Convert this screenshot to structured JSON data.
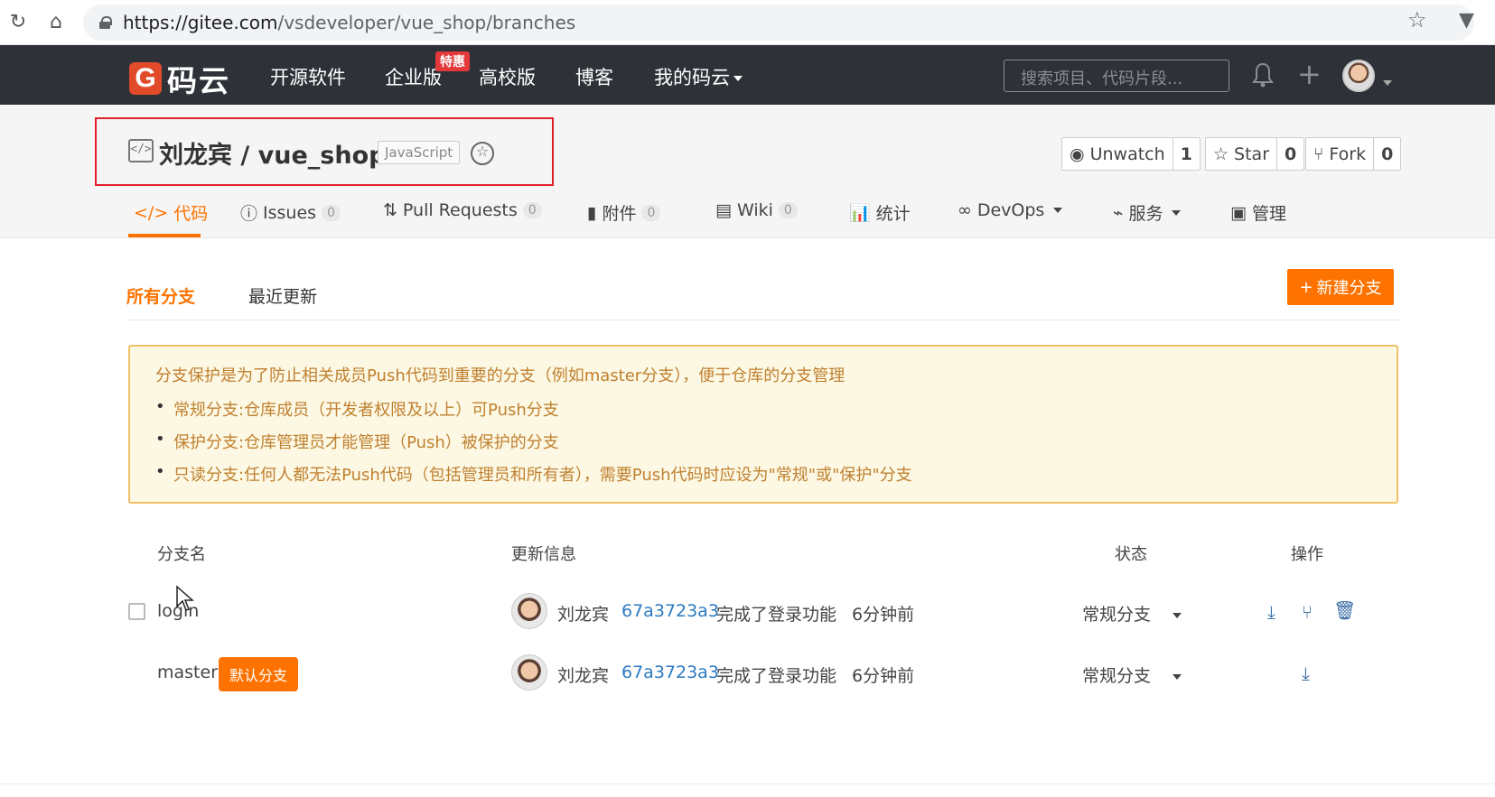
{
  "browser": {
    "url_host": "https://gitee.com",
    "url_path": "/vsdeveloper/vue_shop/branches"
  },
  "topnav": {
    "logo_text": "码云",
    "items": [
      {
        "label": "开源软件"
      },
      {
        "label": "企业版"
      },
      {
        "label": "高校版"
      },
      {
        "label": "博客"
      },
      {
        "label": "我的码云"
      }
    ],
    "hot_badge": "特惠",
    "search_placeholder": "搜索项目、代码片段..."
  },
  "repo": {
    "title": "刘龙宾 / vue_shop",
    "language": "JavaScript",
    "watch": {
      "label": "Unwatch",
      "count": "1"
    },
    "star": {
      "label": "Star",
      "count": "0"
    },
    "fork": {
      "label": "Fork",
      "count": "0"
    }
  },
  "repo_tabs": [
    {
      "label": "代码"
    },
    {
      "label": "Issues",
      "count": "0"
    },
    {
      "label": "Pull Requests",
      "count": "0"
    },
    {
      "label": "附件",
      "count": "0"
    },
    {
      "label": "Wiki",
      "count": "0"
    },
    {
      "label": "统计"
    },
    {
      "label": "DevOps"
    },
    {
      "label": "服务"
    },
    {
      "label": "管理"
    }
  ],
  "branches": {
    "subtabs": [
      "所有分支",
      "最近更新"
    ],
    "new_branch_label": "新建分支",
    "notice": {
      "head": "分支保护是为了防止相关成员Push代码到重要的分支（例如master分支），便于仓库的分支管理",
      "items": [
        "常规分支:仓库成员（开发者权限及以上）可Push分支",
        "保护分支:仓库管理员才能管理（Push）被保护的分支",
        "只读分支:任何人都无法Push代码（包括管理员和所有者），需要Push代码时应设为\"常规\"或\"保护\"分支"
      ]
    },
    "columns": [
      "分支名",
      "更新信息",
      "状态",
      "操作"
    ],
    "rows": [
      {
        "name": "login",
        "author": "刘龙宾",
        "commit": "67a3723a3",
        "message": "完成了登录功能",
        "time": "6分钟前",
        "status": "常规分支"
      },
      {
        "name": "master",
        "default_label": "默认分支",
        "author": "刘龙宾",
        "commit": "67a3723a3",
        "message": "完成了登录功能",
        "time": "6分钟前",
        "status": "常规分支"
      }
    ]
  }
}
